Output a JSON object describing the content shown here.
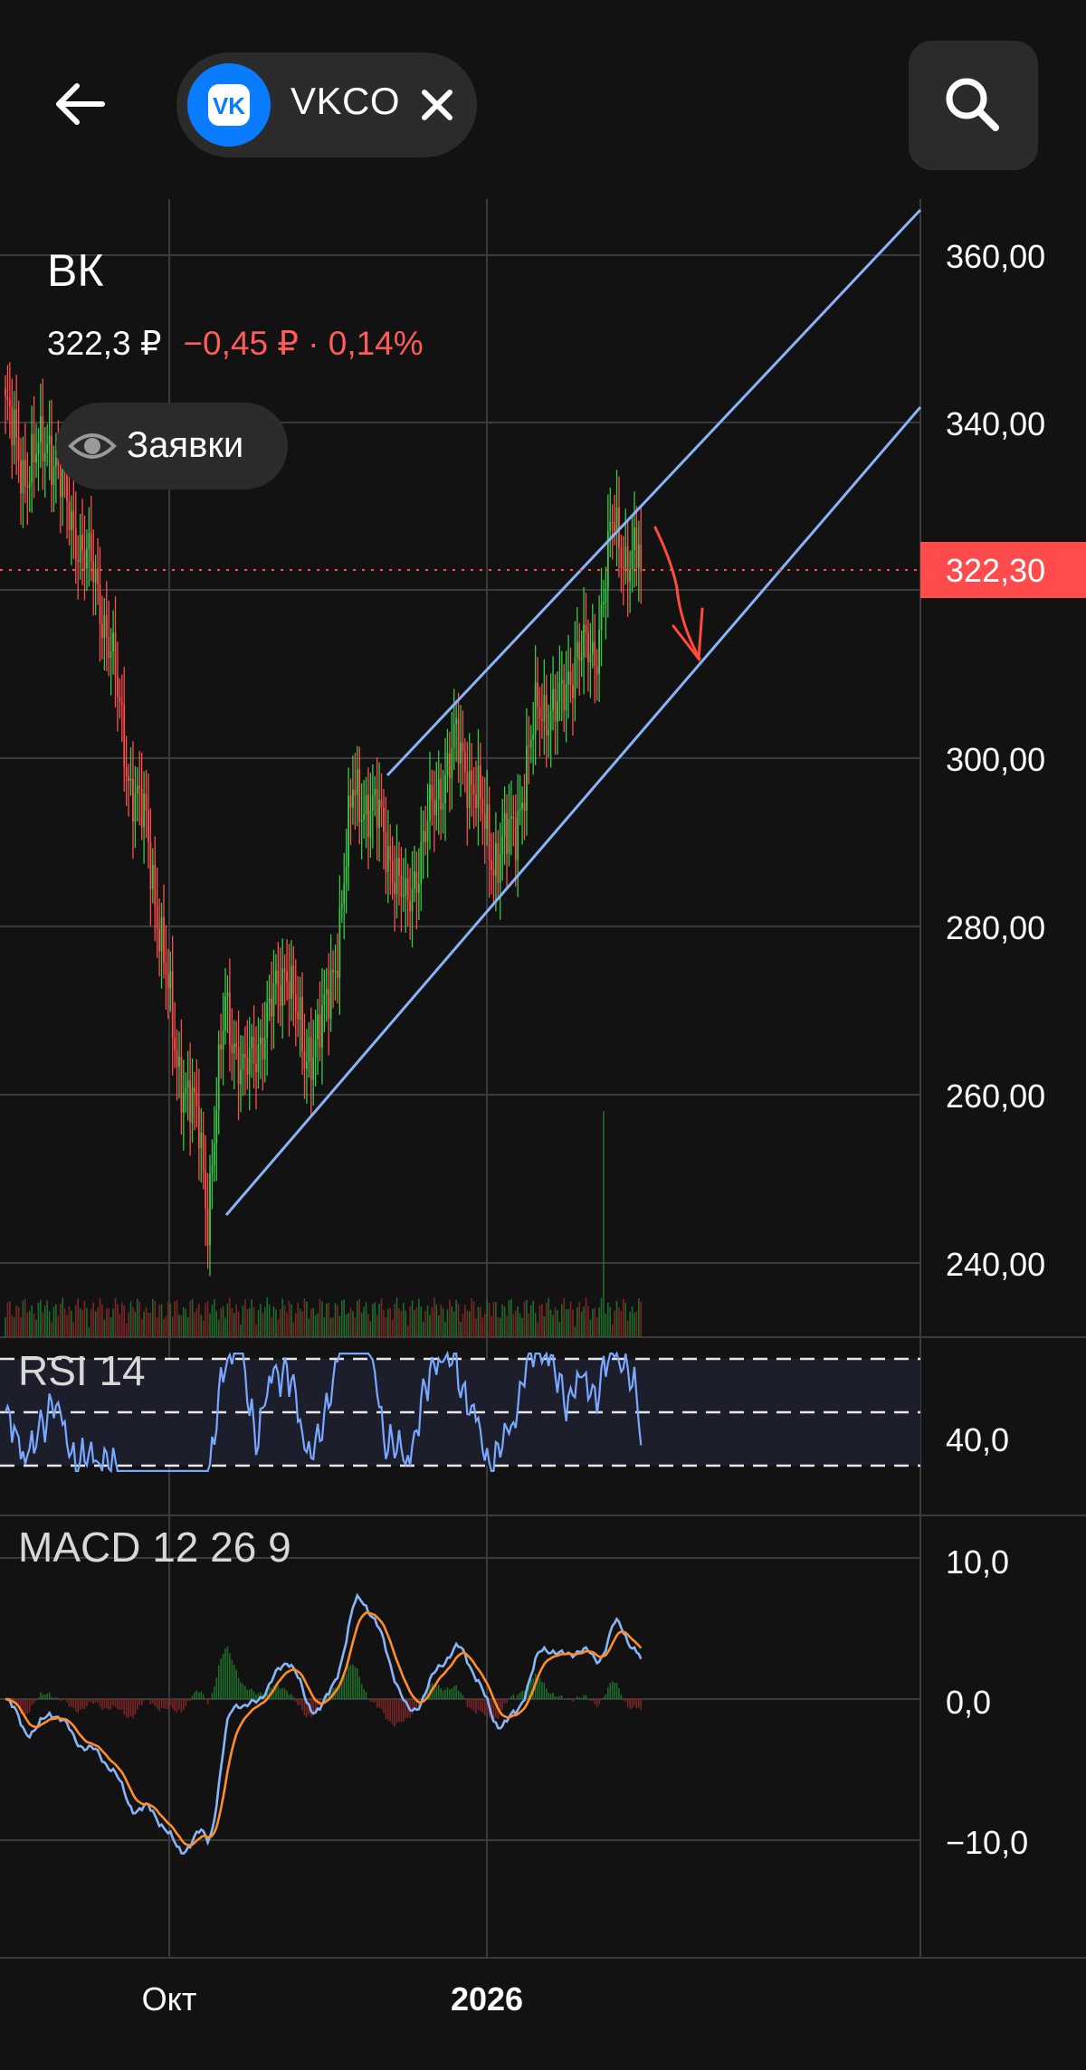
{
  "header": {
    "ticker": "VKCO",
    "back_icon": "arrow-left-icon",
    "logo_icon": "vk-logo-icon",
    "close_icon": "close-icon",
    "search_icon": "search-icon"
  },
  "quote": {
    "name": "ВК",
    "price": "322,3 ₽",
    "change": "−0,45 ₽ · 0,14%",
    "orders_label": "Заявки",
    "orders_icon": "eye-icon"
  },
  "colors": {
    "background": "#121212",
    "up": "#39c84a",
    "down": "#ff4d4d",
    "channel": "#8ab4f8",
    "rsi_line": "#7aa7ff",
    "macd_line": "#8ab4f8",
    "signal_line": "#ff8c2a",
    "annotation": "#ff4a3d",
    "price_tag": "#ff4b4b"
  },
  "chart_data": {
    "type": "candlestick",
    "price_axis": {
      "ticks": [
        "360,00",
        "340,00",
        "300,00",
        "280,00",
        "260,00",
        "240,00"
      ],
      "range": [
        232,
        369
      ]
    },
    "last_price_tag": "322,30",
    "x_labels": [
      "Окт",
      "2026"
    ],
    "rsi": {
      "label": "RSI 14",
      "tick": "40,0"
    },
    "macd": {
      "label": "MACD 12 26 9",
      "ticks": [
        "10,0",
        "0,0",
        "−10,0"
      ]
    },
    "anchors": [
      [
        0,
        342
      ],
      [
        8,
        334
      ],
      [
        20,
        338
      ],
      [
        30,
        328
      ],
      [
        40,
        322
      ],
      [
        48,
        313
      ],
      [
        56,
        298
      ],
      [
        64,
        292
      ],
      [
        70,
        280
      ],
      [
        78,
        264
      ],
      [
        88,
        256
      ],
      [
        92,
        246
      ],
      [
        100,
        271
      ],
      [
        108,
        262
      ],
      [
        118,
        268
      ],
      [
        128,
        276
      ],
      [
        136,
        264
      ],
      [
        146,
        270
      ],
      [
        150,
        276
      ],
      [
        158,
        296
      ],
      [
        170,
        293
      ],
      [
        182,
        282
      ],
      [
        194,
        294
      ],
      [
        205,
        302
      ],
      [
        214,
        296
      ],
      [
        222,
        288
      ],
      [
        232,
        292
      ],
      [
        242,
        306
      ],
      [
        252,
        306
      ],
      [
        260,
        313
      ],
      [
        268,
        312
      ],
      [
        276,
        328
      ],
      [
        282,
        324
      ]
    ],
    "volume_spike_index": 272
  }
}
